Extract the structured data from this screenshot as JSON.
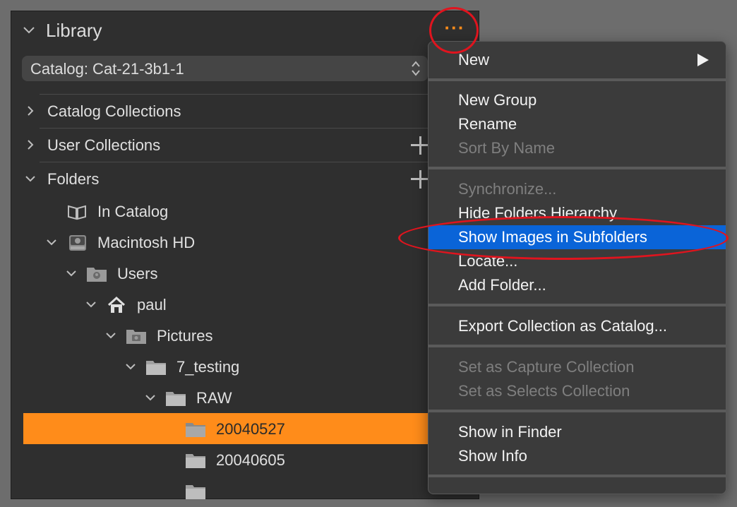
{
  "library": {
    "title": "Library",
    "catalog_select": "Catalog: Cat-21-3b1-1",
    "sections": {
      "catalog_collections": "Catalog Collections",
      "user_collections": "User Collections",
      "folders": "Folders"
    },
    "tree": {
      "in_catalog": "In Catalog",
      "macintosh_hd": "Macintosh HD",
      "users": "Users",
      "paul": "paul",
      "pictures": "Pictures",
      "seven_testing": "7_testing",
      "raw": "RAW",
      "f1": "20040527",
      "f2": "20040605"
    }
  },
  "menu": {
    "new": "New",
    "new_group": "New Group",
    "rename": "Rename",
    "sort_by_name": "Sort By Name",
    "synchronize": "Synchronize...",
    "hide_folders_hierarchy": "Hide Folders Hierarchy",
    "show_images_in_subfolders": "Show Images in Subfolders",
    "locate": "Locate...",
    "add_folder": "Add Folder...",
    "export_collection": "Export Collection as Catalog...",
    "set_capture": "Set as Capture Collection",
    "set_selects": "Set as Selects Collection",
    "show_in_finder": "Show in Finder",
    "show_info": "Show Info"
  },
  "colors": {
    "accent_orange": "#ff8c1a",
    "highlight_blue": "#0a64d8",
    "annotation_red": "#e0141e"
  }
}
